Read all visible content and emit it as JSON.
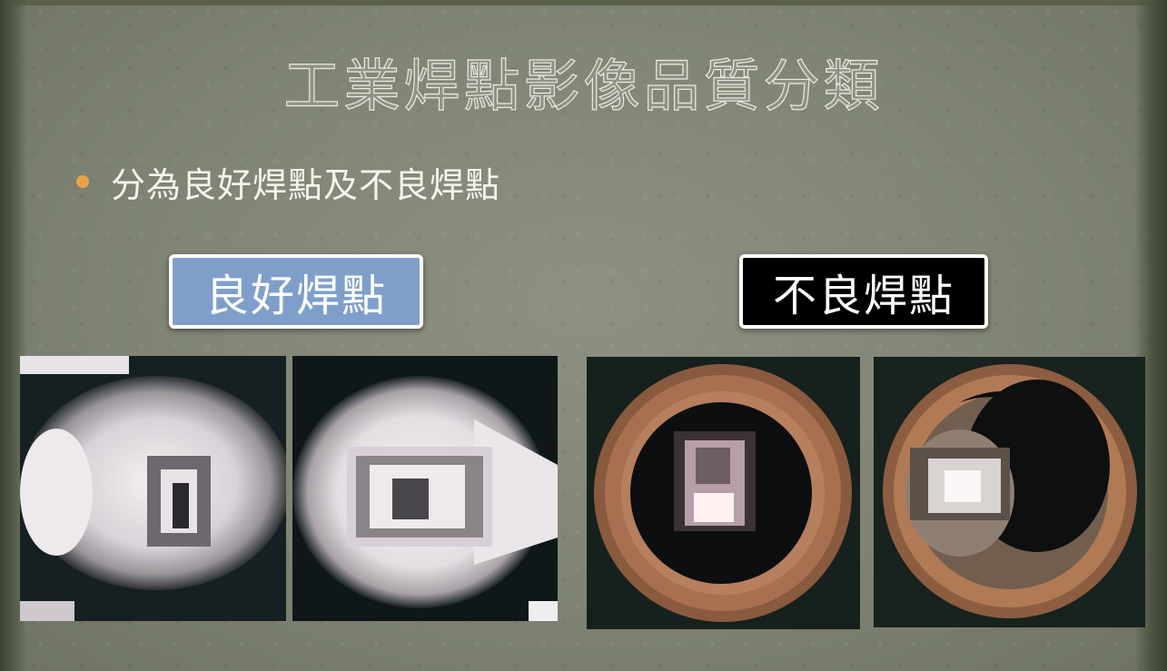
{
  "slide": {
    "title": "工業焊點影像品質分類",
    "bullet": "分為良好焊點及不良焊點"
  },
  "labels": {
    "good": "良好焊點",
    "bad": "不良焊點"
  },
  "colors": {
    "background": "#7f8474",
    "bullet_dot": "#e9a24a",
    "good_label_bg": "#7f9fcb",
    "bad_label_bg": "#000000"
  }
}
